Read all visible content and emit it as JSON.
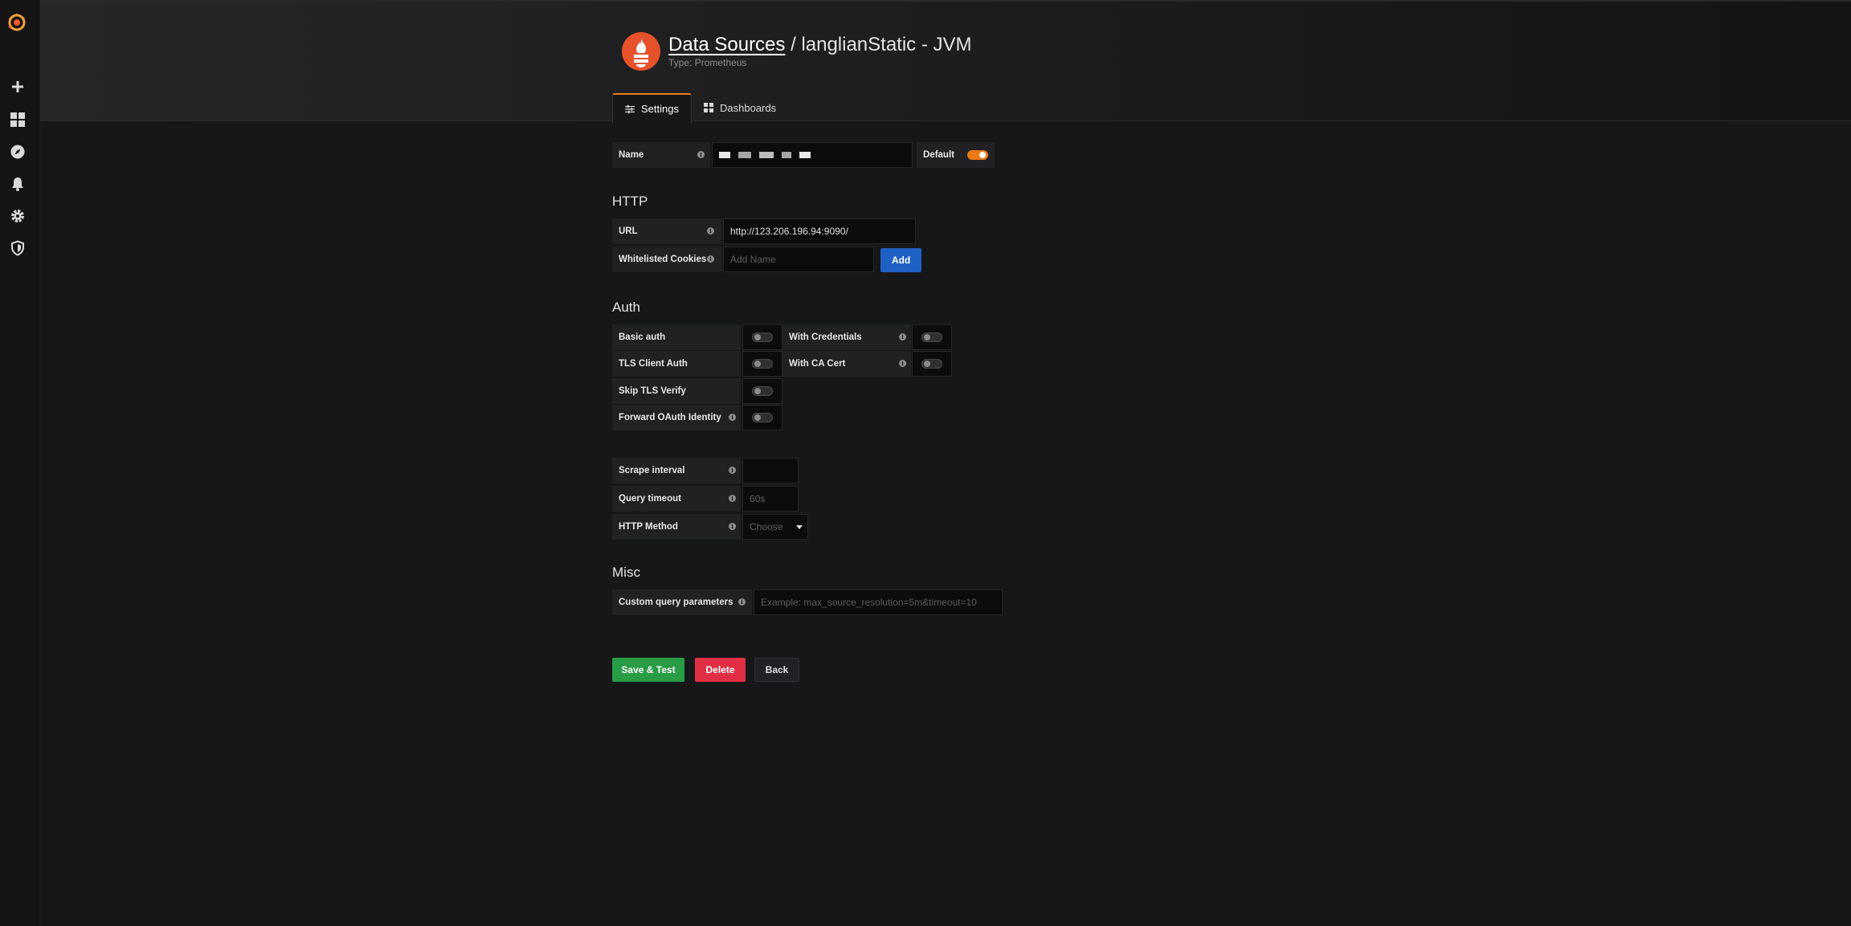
{
  "sidebar": {
    "items": [
      {
        "icon": "plus-icon"
      },
      {
        "icon": "dashboards-icon"
      },
      {
        "icon": "explore-icon"
      },
      {
        "icon": "bell-icon"
      },
      {
        "icon": "gear-icon"
      },
      {
        "icon": "shield-icon"
      }
    ]
  },
  "header": {
    "breadcrumb": "Data Sources",
    "separator": "/",
    "title": "langlianStatic - JVM",
    "subtitle": "Type: Prometheus"
  },
  "tabs": [
    {
      "label": "Settings",
      "icon": "sliders-icon",
      "active": true
    },
    {
      "label": "Dashboards",
      "icon": "grid-icon",
      "active": false
    }
  ],
  "name_field": {
    "label": "Name",
    "value_redacted": true,
    "default_label": "Default",
    "default_on": true
  },
  "http": {
    "title": "HTTP",
    "url_label": "URL",
    "url_value": "http://123.206.196.94:9090/",
    "cookies_label": "Whitelisted Cookies",
    "cookies_placeholder": "Add Name",
    "add_button": "Add"
  },
  "auth": {
    "title": "Auth",
    "basic_auth": "Basic auth",
    "with_credentials": "With Credentials",
    "tls_client_auth": "TLS Client Auth",
    "with_ca_cert": "With CA Cert",
    "skip_tls_verify": "Skip TLS Verify",
    "forward_oauth": "Forward OAuth Identity"
  },
  "prometheus": {
    "scrape_label": "Scrape interval",
    "scrape_value": "",
    "timeout_label": "Query timeout",
    "timeout_placeholder": "60s",
    "method_label": "HTTP Method",
    "method_placeholder": "Choose"
  },
  "misc": {
    "title": "Misc",
    "custom_label": "Custom query parameters",
    "custom_placeholder": "Example: max_source_resolution=5m&timeout=10"
  },
  "actions": {
    "save": "Save & Test",
    "delete": "Delete",
    "back": "Back"
  },
  "colors": {
    "accent": "#eb7b18",
    "save": "#299c46",
    "delete": "#e02f44",
    "add": "#1f60c4"
  }
}
